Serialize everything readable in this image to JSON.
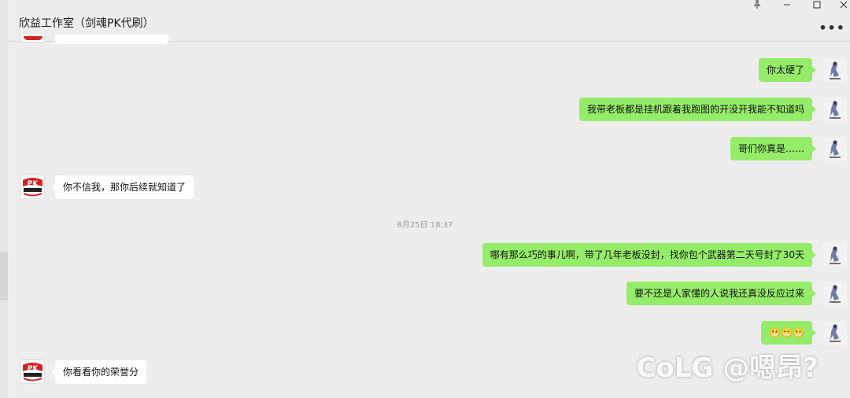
{
  "window": {
    "title": "欣益工作室（剑魂PK代刷）",
    "more_label": "•••"
  },
  "messages": [
    {
      "side": "me",
      "text": "你太硬了"
    },
    {
      "side": "me",
      "text": "我带老板都是挂机跟着我跑图的开没开我能不知道吗"
    },
    {
      "side": "me",
      "text": "哥们你真是……"
    },
    {
      "side": "other",
      "text": "你不信我，那你后续就知道了"
    },
    {
      "side": "me",
      "text": "哪有那么巧的事儿啊，带了几年老板没封，找你包个武器第二天号封了30天"
    },
    {
      "side": "me",
      "text": "要不还是人家懂的人说我还真没反应过来"
    },
    {
      "side": "me",
      "text": "😬😬😬"
    },
    {
      "side": "other",
      "text": "你看看你的荣誉分"
    }
  ],
  "timestamp": "8月25日 18:37",
  "other_avatar_text": "PK",
  "watermark": "CoLG @嗯昂?",
  "colors": {
    "bubble_me": "#95ec69",
    "bubble_other": "#ffffff",
    "background": "#ededed"
  }
}
